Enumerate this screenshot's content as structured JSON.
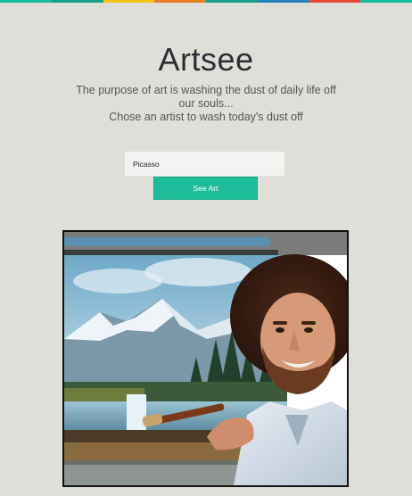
{
  "header": {
    "stripe_colors": [
      "#1abc9c",
      "#16a085",
      "#f1c40f",
      "#e67e22",
      "#16a085",
      "#2980b9",
      "#e74c3c",
      "#1abc9c"
    ]
  },
  "hero": {
    "title": "Artsee",
    "subtitle_line1": "The purpose of art is washing the dust of daily life off our souls...",
    "subtitle_line2": "Chose an artist to wash today's dust off"
  },
  "search": {
    "value": "Picasso",
    "button_label": "See Art"
  },
  "artwork": {
    "description_icon": "painter-portrait-image"
  },
  "colors": {
    "background": "#e0ded8",
    "accent": "#1fbc99",
    "title": "#2c2d33"
  }
}
